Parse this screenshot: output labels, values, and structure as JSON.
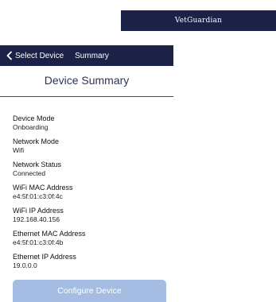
{
  "colors": {
    "brand_navy": "#1c2247",
    "title_text": "#2b3358",
    "button_disabled": "#a6bde3"
  },
  "logo": {
    "text": "VetGuardian"
  },
  "nav": {
    "back_label": "Select Device",
    "back_icon": "chevron-left-icon",
    "title": "Summary"
  },
  "page": {
    "title": "Device Summary"
  },
  "fields": [
    {
      "label": "Device Mode",
      "value": "Onboarding"
    },
    {
      "label": "Network Mode",
      "value": "Wifi"
    },
    {
      "label": "Network Status",
      "value": "Connected"
    },
    {
      "label": "WiFi MAC Address",
      "value": "e4:5f:01:c3:0f:4c"
    },
    {
      "label": "WiFi IP Address",
      "value": "192.168.40.156"
    },
    {
      "label": "Ethernet MAC Address",
      "value": "e4:5f:01:c3:0f:4b"
    },
    {
      "label": "Ethernet IP Address",
      "value": "19.0.0.0"
    }
  ],
  "actions": {
    "configure_label": "Configure Device"
  }
}
